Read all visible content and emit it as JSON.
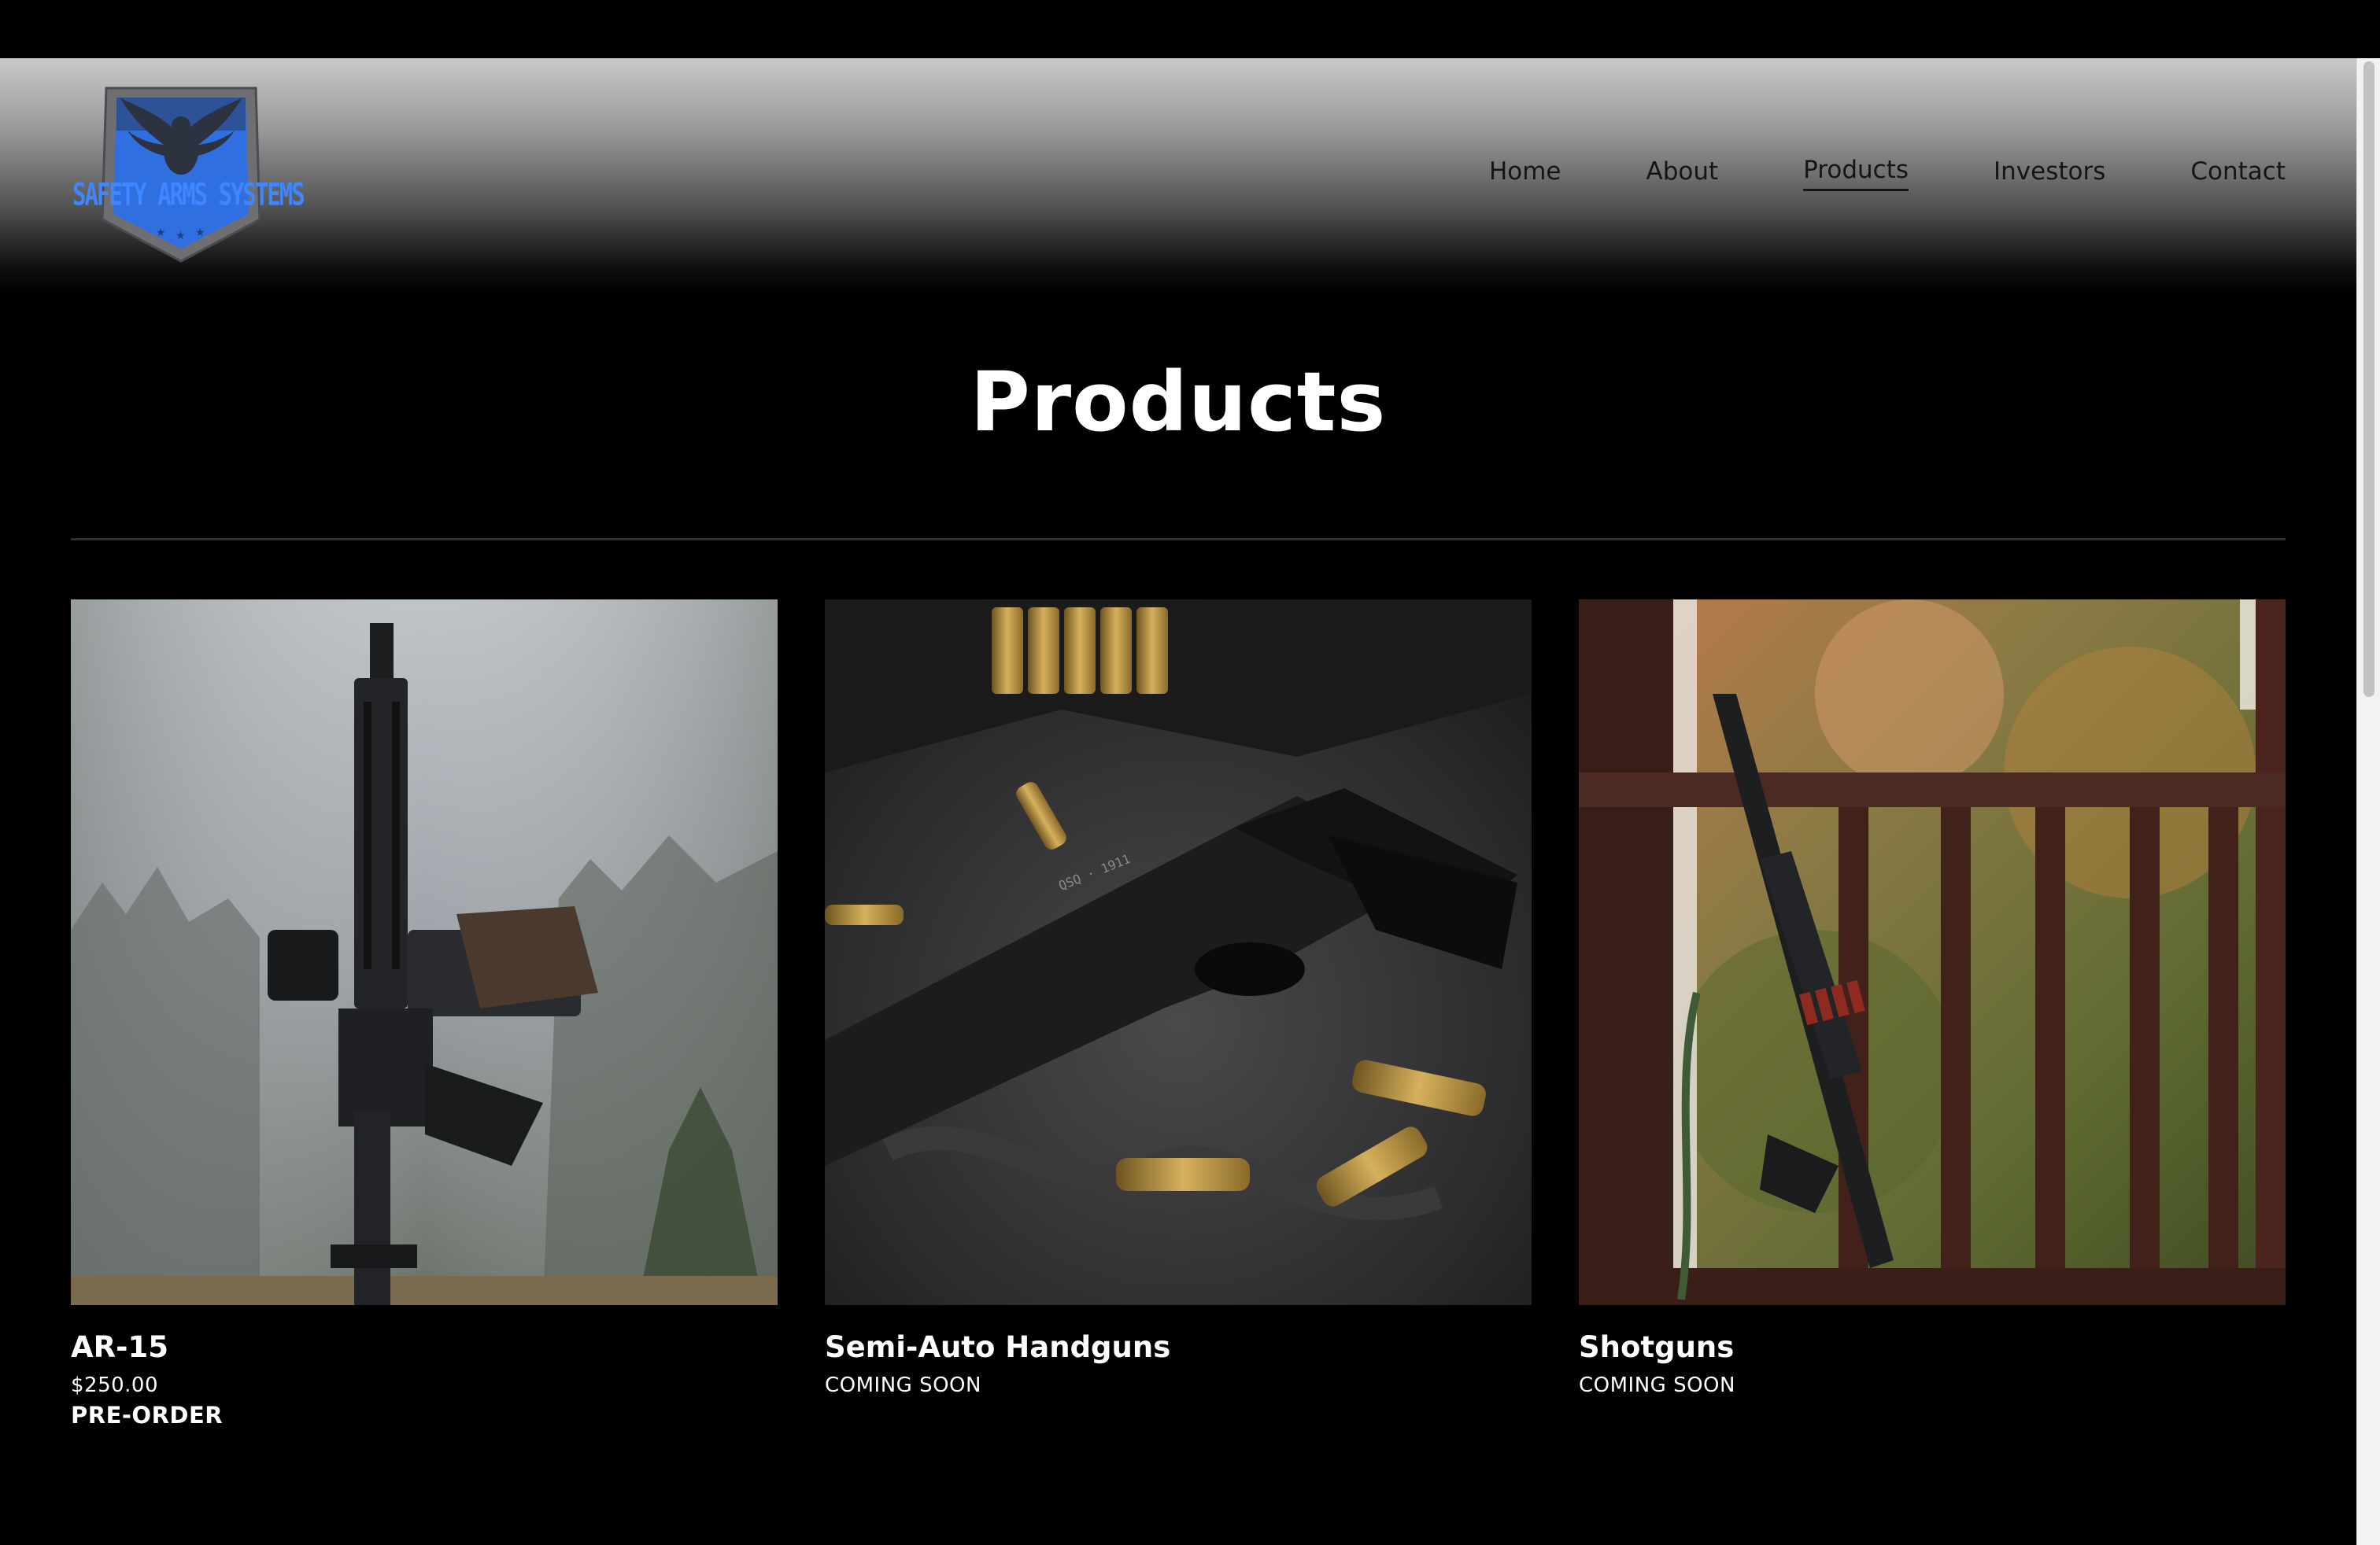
{
  "brand": {
    "logo_text": "SAFETY ARMS SYSTEMS",
    "colors": {
      "logo_blue": "#2f6fe0",
      "logo_shield": "#6d6f73"
    }
  },
  "nav": {
    "items": [
      {
        "label": "Home",
        "active": false
      },
      {
        "label": "About",
        "active": false
      },
      {
        "label": "Products",
        "active": true
      },
      {
        "label": "Investors",
        "active": false
      },
      {
        "label": "Contact",
        "active": false
      }
    ]
  },
  "page": {
    "title": "Products"
  },
  "products": [
    {
      "name": "AR-15",
      "price": "$250.00",
      "action": "PRE-ORDER",
      "image_subject": "ar15-rifle-photo"
    },
    {
      "name": "Semi-Auto Handguns",
      "status": "COMING SOON",
      "image_subject": "pistol-with-ammo-photo"
    },
    {
      "name": "Shotguns",
      "status": "COMING SOON",
      "image_subject": "shotgun-on-porch-photo"
    }
  ]
}
